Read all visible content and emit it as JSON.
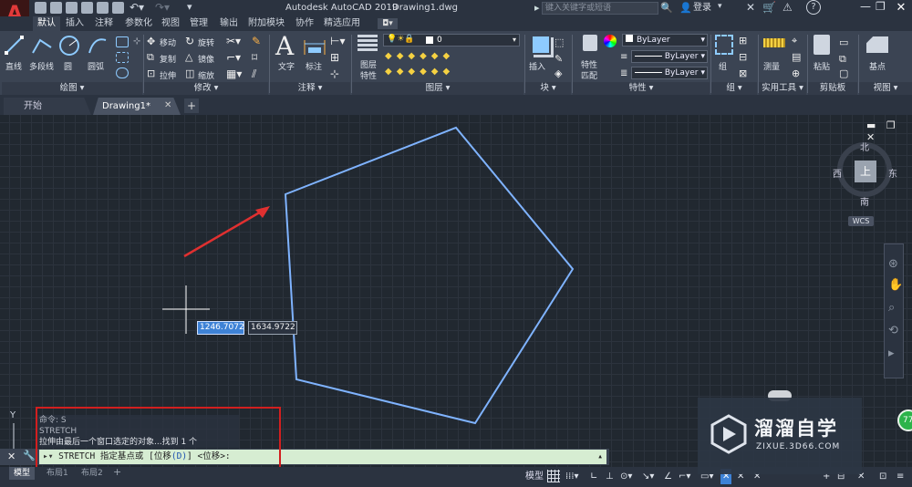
{
  "app": {
    "title": "Autodesk AutoCAD 2019",
    "document": "Drawing1.dwg",
    "logo_letter": "A",
    "search_placeholder": "键入关键字或短语",
    "signin": "登录"
  },
  "ribbon_tabs": [
    "默认",
    "插入",
    "注释",
    "参数化",
    "视图",
    "管理",
    "输出",
    "附加模块",
    "协作",
    "精选应用"
  ],
  "draw": {
    "line": "直线",
    "polyline": "多段线",
    "circle": "圆",
    "arc": "圆弧"
  },
  "modify": {
    "move": "移动",
    "rotate": "旋转",
    "copy": "复制",
    "mirror": "镜像",
    "stretch": "拉伸",
    "scale": "缩放"
  },
  "annotation": {
    "text": "文字",
    "dimension": "标注"
  },
  "layers": {
    "props_line1": "图层",
    "props_line2": "特性",
    "current": "0"
  },
  "block": {
    "insert": "插入"
  },
  "properties": {
    "match_line1": "特性",
    "match_line2": "匹配",
    "color": "ByLayer",
    "linetype": "ByLayer",
    "lineweight": "ByLayer"
  },
  "group": {
    "label": "组"
  },
  "utilities": {
    "measure": "测量"
  },
  "clipboard": {
    "paste": "粘贴"
  },
  "base": {
    "label": "基点"
  },
  "panels": {
    "draw": "绘图",
    "modify": "修改",
    "annotation": "注释",
    "layers": "图层",
    "block": "块",
    "properties": "特性",
    "groups": "组",
    "utilities": "实用工具",
    "clipboard": "剪贴板",
    "view": "视图"
  },
  "file_tabs": {
    "start": "开始",
    "drawing": "Drawing1*"
  },
  "viewcube": {
    "north": "北",
    "south": "南",
    "east": "东",
    "west": "西",
    "top": "上",
    "wcs": "WCS"
  },
  "cursor": {
    "x_value": "1246.7072",
    "y_value": "1634.9722"
  },
  "ucs": {
    "y_label": "Y"
  },
  "command": {
    "history": [
      "命令: S",
      "STRETCH",
      "拉伸由最后一个窗口选定的对象...找到 1 个"
    ],
    "prompt_main": "STRETCH 指定基点或 [位移",
    "prompt_key": "(D)",
    "prompt_tail": "] <位移>:"
  },
  "layout_tabs": {
    "model": "模型",
    "layout1": "布局1",
    "layout2": "布局2"
  },
  "status": {
    "model": "模型"
  },
  "watermark": {
    "brand": "溜溜自学",
    "url": "ZIXUE.3D66.COM"
  },
  "badge": "77"
}
